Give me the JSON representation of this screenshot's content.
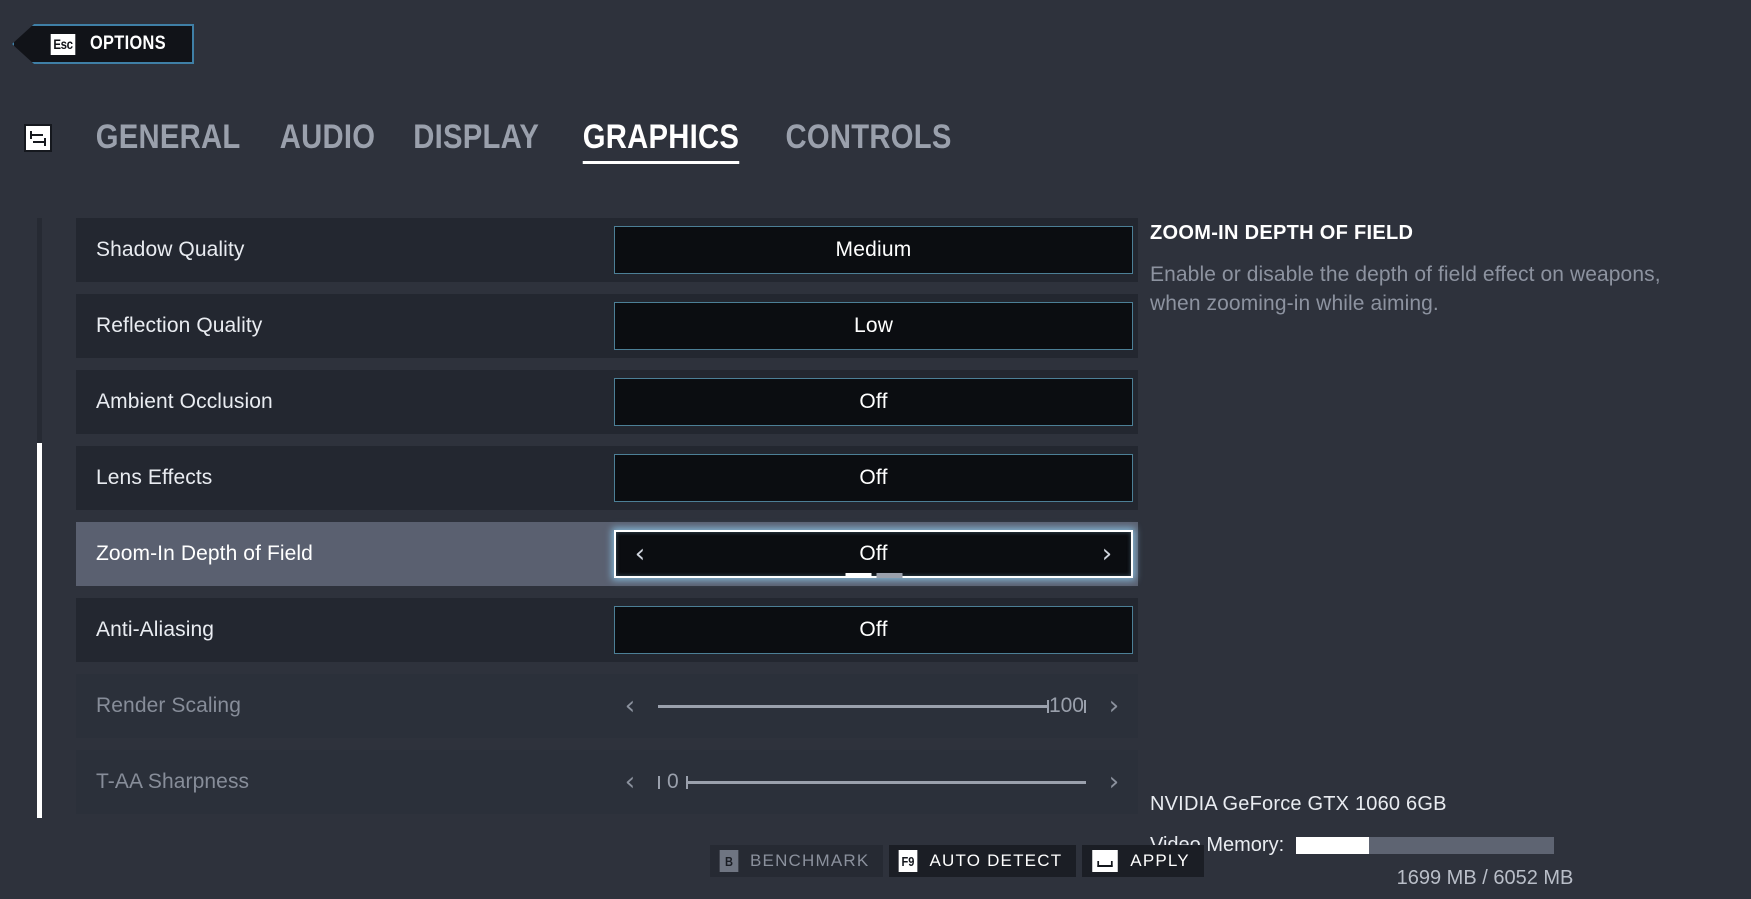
{
  "header": {
    "esc_key": "Esc",
    "esc_label": "OPTIONS"
  },
  "tabs": {
    "icon": "sliders-icon",
    "items": [
      {
        "label": "GENERAL",
        "active": false
      },
      {
        "label": "AUDIO",
        "active": false
      },
      {
        "label": "DISPLAY",
        "active": false
      },
      {
        "label": "GRAPHICS",
        "active": true
      },
      {
        "label": "CONTROLS",
        "active": false
      }
    ]
  },
  "settings": [
    {
      "label": "Shadow Quality",
      "value": "Medium",
      "state": "normal"
    },
    {
      "label": "Reflection Quality",
      "value": "Low",
      "state": "normal"
    },
    {
      "label": "Ambient Occlusion",
      "value": "Off",
      "state": "normal"
    },
    {
      "label": "Lens Effects",
      "value": "Off",
      "state": "normal"
    },
    {
      "label": "Zoom-In Depth of Field",
      "value": "Off",
      "state": "selected"
    },
    {
      "label": "Anti-Aliasing",
      "value": "Off",
      "state": "normal"
    },
    {
      "label": "Render Scaling",
      "value": "100",
      "state": "disabled-slider-right"
    },
    {
      "label": "T-AA Sharpness",
      "value": "0",
      "state": "disabled-slider-left"
    }
  ],
  "arrows": {
    "left": "‹",
    "right": "›"
  },
  "pagination": {
    "pages": 2,
    "current": 1
  },
  "info": {
    "title": "ZOOM-IN DEPTH OF FIELD",
    "description": "Enable or disable the depth of field effect on weapons, when zooming-in while aiming."
  },
  "gpu": {
    "name": "NVIDIA GeForce GTX 1060 6GB",
    "vmem_label": "Video Memory:",
    "vmem_text": "1699 MB / 6052 MB",
    "vmem_used_mb": 1699,
    "vmem_total_mb": 6052
  },
  "buttons": [
    {
      "key": "B",
      "label": "BENCHMARK",
      "style": "dim",
      "keystyle": "dim"
    },
    {
      "key": "F9",
      "label": "AUTO DETECT",
      "style": "dark",
      "keystyle": "light"
    },
    {
      "key": "",
      "label": "APPLY",
      "style": "dark",
      "keystyle": "space"
    }
  ],
  "colors": {
    "background": "#2e323c",
    "row": "#232730",
    "row_selected": "#5a6070",
    "value_box": "#0b0d11",
    "accent_border": "#4c7f96",
    "highlight": "#ffffff",
    "muted_text": "#8d93a0"
  }
}
